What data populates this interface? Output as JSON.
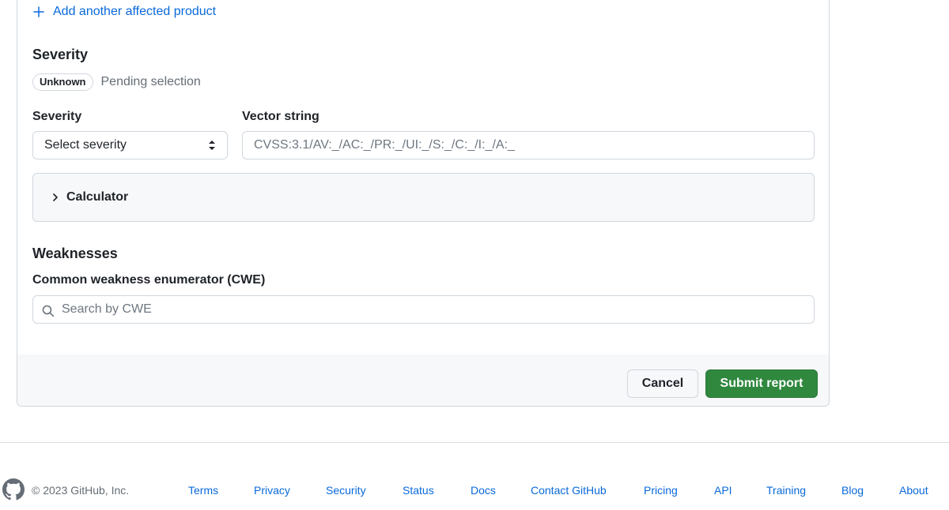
{
  "form": {
    "add_product_label": "Add another affected product",
    "severity_heading": "Severity",
    "severity_badge": "Unknown",
    "severity_status": "Pending selection",
    "severity_label": "Severity",
    "severity_select_value": "Select severity",
    "vector_label": "Vector string",
    "vector_placeholder": "CVSS:3.1/AV:_/AC:_/PR:_/UI:_/S:_/C:_/I:_/A:_",
    "calculator_label": "Calculator",
    "weaknesses_heading": "Weaknesses",
    "cwe_label": "Common weakness enumerator (CWE)",
    "cwe_placeholder": "Search by CWE",
    "cancel_label": "Cancel",
    "submit_label": "Submit report"
  },
  "footer": {
    "copyright": "© 2023 GitHub, Inc.",
    "links": [
      "Terms",
      "Privacy",
      "Security",
      "Status",
      "Docs",
      "Contact GitHub",
      "Pricing",
      "API",
      "Training",
      "Blog",
      "About"
    ]
  },
  "colors": {
    "link": "#0969da",
    "submit": "#2f883e",
    "border": "#d0d7de",
    "muted": "#656d76"
  }
}
